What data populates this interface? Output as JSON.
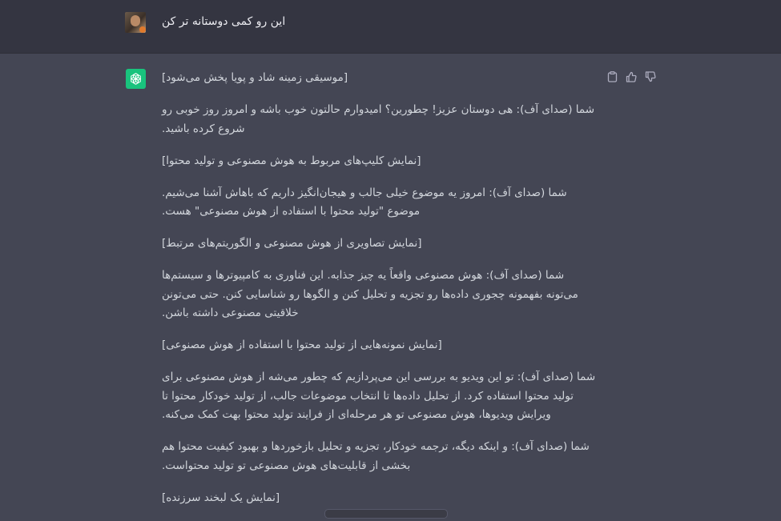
{
  "user": {
    "message": "این رو کمی دوستانه تر کن"
  },
  "assistant": {
    "actions": {
      "copy_icon": "clipboard-icon",
      "like_icon": "thumbs-up-icon",
      "dislike_icon": "thumbs-down-icon"
    },
    "paragraphs": [
      "[موسیقی زمینه شاد و پویا پخش می‌شود]",
      "شما (صدای آف): هی دوستان عزیز! چطورین؟ امیدوارم حالتون خوب باشه و امروز روز خوبی رو شروع کرده باشید.",
      "[نمایش کلیپ‌های مربوط به هوش مصنوعی و تولید محتوا]",
      "شما (صدای آف): امروز یه موضوع خیلی جالب و هیجان‌انگیز داریم که باهاش آشنا می‌شیم. موضوع \"تولید محتوا با استفاده از هوش مصنوعی\" هست.",
      "[نمایش تصاویری از هوش مصنوعی و الگوریتم‌های مرتبط]",
      "شما (صدای آف): هوش مصنوعی واقعاً یه چیز جذابه. این فناوری به کامپیوترها و سیستم‌ها می‌تونه بفهمونه چجوری داده‌ها رو تجزیه و تحلیل کنن و الگوها رو شناسایی کنن. حتی می‌تونن خلاقیتی مصنوعی داشته باشن.",
      "[نمایش نمونه‌هایی از تولید محتوا با استفاده از هوش مصنوعی]",
      "شما (صدای آف): تو این ویدیو به بررسی این می‌پردازیم که چطور می‌شه از هوش مصنوعی برای تولید محتوا استفاده کرد. از تحلیل داده‌ها تا انتخاب موضوعات جالب، از تولید خودکار محتوا تا ویرایش ویدیوها، هوش مصنوعی تو هر مرحله‌ای از فرایند تولید محتوا بهت کمک می‌کنه.",
      "شما (صدای آف): و اینکه دیگه، ترجمه خودکار، تجزیه و تحلیل بازخوردها و بهبود کیفیت محتوا هم بخشی از قابلیت‌های هوش مصنوعی تو تولید محتواست.",
      "[نمایش یک لبخند سرزنده]"
    ]
  }
}
